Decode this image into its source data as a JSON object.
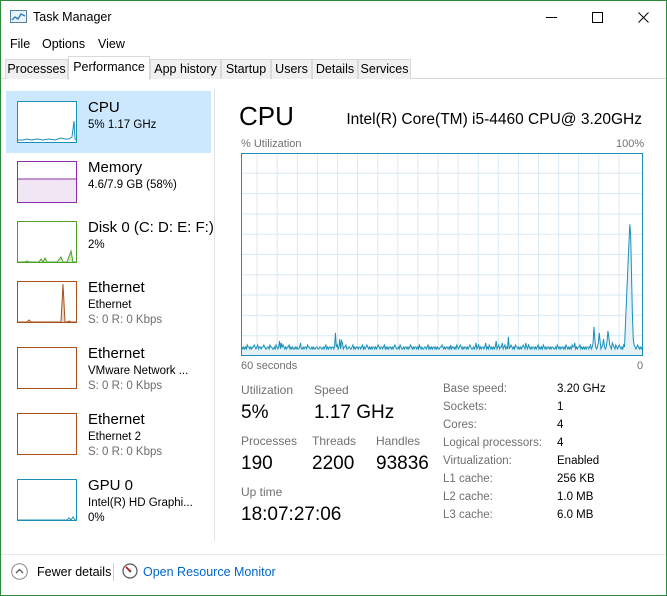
{
  "window": {
    "title": "Task Manager"
  },
  "menu": [
    "File",
    "Options",
    "View"
  ],
  "tabs": [
    "Processes",
    "Performance",
    "App history",
    "Startup",
    "Users",
    "Details",
    "Services"
  ],
  "active_tab": "Performance",
  "sidebar": {
    "items": [
      {
        "title": "CPU",
        "sub": "5%  1.17 GHz",
        "sub2": "",
        "color": "#1a8fb8",
        "selected": true,
        "icon": "cpu-graph-thumbnail"
      },
      {
        "title": "Memory",
        "sub": "4.6/7.9 GB (58%)",
        "sub2": "",
        "color": "#8b2fa8",
        "selected": false,
        "icon": "memory-graph-thumbnail"
      },
      {
        "title": "Disk 0 (C: D: E: F:)",
        "sub": "2%",
        "sub2": "",
        "color": "#4da028",
        "selected": false,
        "icon": "disk-graph-thumbnail"
      },
      {
        "title": "Ethernet",
        "sub": "Ethernet",
        "sub2": "S: 0  R: 0 Kbps",
        "color": "#a7501c",
        "selected": false,
        "icon": "ethernet-graph-thumbnail"
      },
      {
        "title": "Ethernet",
        "sub": "VMware Network ...",
        "sub2": "S: 0  R: 0 Kbps",
        "color": "#a7501c",
        "selected": false,
        "icon": "ethernet-graph-thumbnail"
      },
      {
        "title": "Ethernet",
        "sub": "Ethernet 2",
        "sub2": "S: 0  R: 0 Kbps",
        "color": "#a7501c",
        "selected": false,
        "icon": "ethernet-graph-thumbnail"
      },
      {
        "title": "GPU 0",
        "sub": "Intel(R) HD Graphi...",
        "sub2": "0%",
        "color": "#1a8fb8",
        "selected": false,
        "icon": "gpu-graph-thumbnail"
      }
    ]
  },
  "main": {
    "title": "CPU",
    "model": "Intel(R) Core(TM) i5-4460 CPU@ 3.20GHz",
    "y_label": "% Utilization",
    "y_max": "100%",
    "x_left": "60 seconds",
    "x_right": "0",
    "stats": {
      "utilization_label": "Utilization",
      "utilization": "5%",
      "speed_label": "Speed",
      "speed": "1.17 GHz",
      "processes_label": "Processes",
      "processes": "190",
      "threads_label": "Threads",
      "threads": "2200",
      "handles_label": "Handles",
      "handles": "93836",
      "uptime_label": "Up time",
      "uptime": "18:07:27:06"
    },
    "info": [
      {
        "label": "Base speed:",
        "value": "3.20 GHz"
      },
      {
        "label": "Sockets:",
        "value": "1"
      },
      {
        "label": "Cores:",
        "value": "4"
      },
      {
        "label": "Logical processors:",
        "value": "4"
      },
      {
        "label": "Virtualization:",
        "value": "Enabled"
      },
      {
        "label": "L1 cache:",
        "value": "256 KB"
      },
      {
        "label": "L2 cache:",
        "value": "1.0 MB"
      },
      {
        "label": "L3 cache:",
        "value": "6.0 MB"
      }
    ]
  },
  "footer": {
    "fewer_details": "Fewer details",
    "resource_monitor": "Open Resource Monitor"
  },
  "colors": {
    "cpu": "#1a8fb8",
    "memory": "#8b2fa8",
    "disk": "#4da028",
    "ethernet": "#a7501c",
    "selection": "#cce8ff",
    "link": "#0066cc"
  },
  "cpu_history": [
    4,
    3,
    4,
    3,
    4,
    3,
    5,
    4,
    4,
    3,
    4,
    3,
    4,
    4,
    5,
    4,
    3,
    4,
    5,
    3,
    4,
    4,
    3,
    4,
    4,
    5,
    4,
    3,
    3,
    4,
    4,
    3,
    5,
    4,
    4,
    3,
    3,
    4,
    3,
    5,
    4,
    3,
    4,
    7,
    3,
    6,
    4,
    5,
    4,
    3,
    4,
    3,
    4,
    4,
    5,
    3,
    4,
    3,
    4,
    3,
    3,
    4,
    3,
    4,
    3,
    3,
    4,
    6,
    3,
    3,
    4,
    3,
    4,
    4,
    3,
    5,
    4,
    4,
    3,
    3,
    4,
    3,
    4,
    3,
    3,
    4,
    4,
    3,
    3,
    4,
    4,
    3,
    3,
    4,
    3,
    4,
    5,
    3,
    4,
    3,
    4,
    4,
    3,
    4,
    4,
    3,
    4,
    11,
    4,
    5,
    3,
    4,
    8,
    3,
    7,
    6,
    3,
    4,
    4,
    5,
    3,
    3,
    4,
    4,
    3,
    3,
    4,
    5,
    3,
    4,
    3,
    4,
    4,
    3,
    4,
    4,
    3,
    4,
    5,
    3,
    4,
    3,
    4,
    5,
    4,
    3,
    4,
    3,
    4,
    3,
    4,
    4,
    3,
    4,
    3,
    4,
    5,
    4,
    3,
    4,
    4,
    3,
    4,
    5,
    3,
    4,
    3,
    4,
    3,
    4,
    4,
    3,
    4,
    3,
    4,
    5,
    4,
    3,
    3,
    4,
    3,
    5,
    4,
    3,
    3,
    4,
    3,
    4,
    4,
    3,
    4,
    3,
    4,
    5,
    4,
    3,
    4,
    3,
    4,
    4,
    3,
    4,
    3,
    5,
    4,
    3,
    4,
    3,
    3,
    4,
    4,
    3,
    4,
    5,
    3,
    4,
    3,
    4,
    3,
    4,
    4,
    3,
    4,
    3,
    4,
    3,
    3,
    4,
    4,
    5,
    4,
    3,
    4,
    3,
    4,
    4,
    3,
    4,
    3,
    5,
    3,
    4,
    4,
    3,
    4,
    3,
    5,
    4,
    3,
    4,
    5,
    4,
    3,
    4,
    3,
    4,
    4,
    3,
    4,
    3,
    4,
    5,
    4,
    3,
    3,
    4,
    3,
    4,
    6,
    3,
    4,
    5,
    3,
    4,
    3,
    4,
    4,
    3,
    4,
    6,
    3,
    4,
    3,
    5,
    4,
    3,
    4,
    3,
    4,
    3,
    4,
    7,
    3,
    4,
    5,
    3,
    4,
    4,
    6,
    3,
    4,
    5,
    3,
    4,
    3,
    9,
    3,
    4,
    5,
    4,
    3,
    4,
    3,
    5,
    4,
    4,
    3,
    4,
    3,
    4,
    3,
    4,
    5,
    4,
    3,
    6,
    4,
    3,
    5,
    4,
    3,
    4,
    3,
    4,
    4,
    3,
    4,
    3,
    4,
    5,
    3,
    4,
    3,
    4,
    3,
    5,
    4,
    3,
    4,
    3,
    4,
    4,
    3,
    4,
    3,
    4,
    4,
    3,
    3,
    4,
    3,
    5,
    4,
    3,
    4,
    3,
    4,
    4,
    3,
    4,
    3,
    5,
    4,
    3,
    4,
    3,
    4,
    3,
    5,
    4,
    4,
    6,
    3,
    4,
    3,
    4,
    4,
    5,
    3,
    4,
    3,
    4,
    3,
    4,
    3,
    4,
    4,
    3,
    4,
    5,
    3,
    4,
    6,
    14,
    8,
    4,
    3,
    4,
    6,
    11,
    7,
    3,
    4,
    5,
    8,
    4,
    3,
    4,
    7,
    12,
    9,
    5,
    4,
    3,
    6,
    5,
    4,
    3,
    5,
    4,
    3,
    4,
    5,
    4,
    3,
    4,
    3,
    5,
    4,
    15,
    25,
    35,
    45,
    55,
    65,
    60,
    40,
    20,
    8,
    5,
    4,
    3,
    4,
    5,
    4,
    3,
    4,
    3,
    4
  ]
}
